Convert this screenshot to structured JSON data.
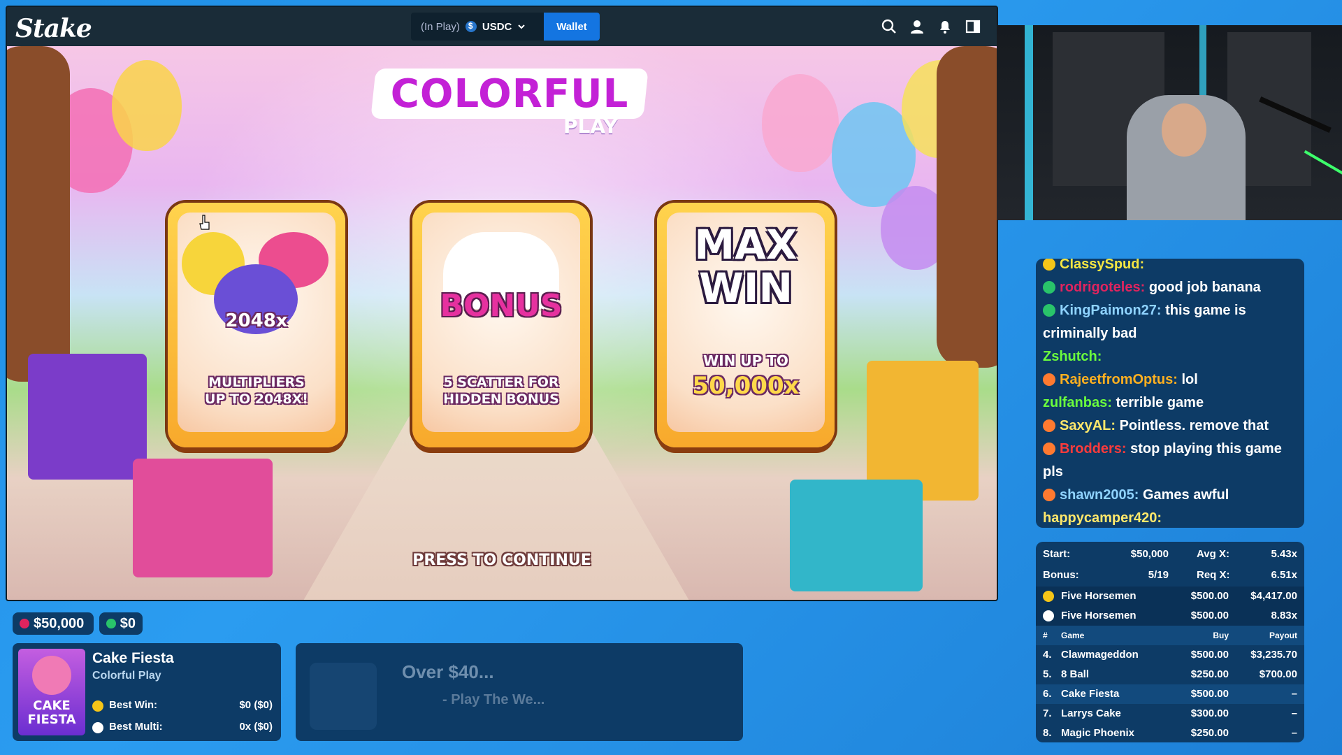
{
  "topbar": {
    "logo": "Stake",
    "balance_status": "(In Play)",
    "currency": "USDC",
    "wallet_label": "Wallet"
  },
  "game": {
    "title": "COLORFUL",
    "subtitle": "PLAY",
    "cards": [
      {
        "art_text": "2048x",
        "caption_line1": "MULTIPLIERS",
        "caption_line2": "UP TO 2048X!"
      },
      {
        "art_text": "BONUS",
        "caption_line1": "5 SCATTER FOR",
        "caption_line2": "HIDDEN BONUS"
      },
      {
        "art_line1": "MAX",
        "art_line2": "WIN",
        "caption_line1": "WIN UP TO",
        "caption_line2": "50,000x"
      }
    ],
    "press_continue": "PRESS TO CONTINUE"
  },
  "chat": {
    "messages": [
      {
        "user": "ClassySpud:",
        "text": "",
        "color": "#f5e642"
      },
      {
        "user": "rodrigoteles:",
        "text": "good job banana",
        "color": "#e0245e"
      },
      {
        "user": "KingPaimon27:",
        "text": "this game is",
        "color": "#8fd3ff"
      },
      {
        "user": "",
        "text": "criminally bad",
        "color": "#ffffff"
      },
      {
        "user": "Zshutch:",
        "text": "",
        "color": "#6bff3d"
      },
      {
        "user": "RajeetfromOptus:",
        "text": "lol",
        "color": "#ffb020"
      },
      {
        "user": "zulfanbas:",
        "text": "terrible game",
        "color": "#6bff3d"
      },
      {
        "user": "SaxyAL:",
        "text": "Pointless. remove that",
        "color": "#ffe86b"
      },
      {
        "user": "Brodders:",
        "text": "stop playing this game",
        "color": "#ff3b3b"
      },
      {
        "user": "",
        "text": "pls",
        "color": "#ffffff"
      },
      {
        "user": "shawn2005:",
        "text": "Games awful",
        "color": "#8fd3ff"
      },
      {
        "user": "happycamper420:",
        "text": "",
        "color": "#ffe86b"
      }
    ]
  },
  "stats": {
    "start_label": "Start:",
    "start_value": "$50,000",
    "avgx_label": "Avg X:",
    "avgx_value": "5.43x",
    "bonus_label": "Bonus:",
    "bonus_value": "5/19",
    "reqx_label": "Req X:",
    "reqx_value": "6.51x",
    "best": [
      {
        "name": "Five Horsemen",
        "buy": "$500.00",
        "result": "$4,417.00"
      },
      {
        "name": "Five Horsemen",
        "buy": "$500.00",
        "result": "8.83x"
      }
    ],
    "headers": {
      "num": "#",
      "game": "Game",
      "buy": "Buy",
      "payout": "Payout"
    },
    "rows": [
      {
        "num": "4.",
        "game": "Clawmageddon",
        "buy": "$500.00",
        "payout": "$3,235.70"
      },
      {
        "num": "5.",
        "game": "8 Ball",
        "buy": "$250.00",
        "payout": "$700.00"
      },
      {
        "num": "6.",
        "game": "Cake Fiesta",
        "buy": "$500.00",
        "payout": "–"
      },
      {
        "num": "7.",
        "game": "Larrys Cake",
        "buy": "$300.00",
        "payout": "–"
      },
      {
        "num": "8.",
        "game": "Magic Phoenix",
        "buy": "$250.00",
        "payout": "–"
      }
    ]
  },
  "bottom": {
    "balance_start": "$50,000",
    "balance_profit": "$0",
    "current_game": {
      "name": "Cake Fiesta",
      "provider": "Colorful Play",
      "thumb_line1": "CAKE",
      "thumb_line2": "FIESTA",
      "best_win_label": "Best Win:",
      "best_win_value": "$0 ($0)",
      "best_multi_label": "Best Multi:",
      "best_multi_value": "0x ($0)"
    },
    "promo": {
      "title": "Over $40...",
      "subtitle": "- Play The We..."
    }
  },
  "colors": {
    "accent": "#1475e1",
    "panel": "#0d3b66",
    "background": "#2b9cf0"
  }
}
